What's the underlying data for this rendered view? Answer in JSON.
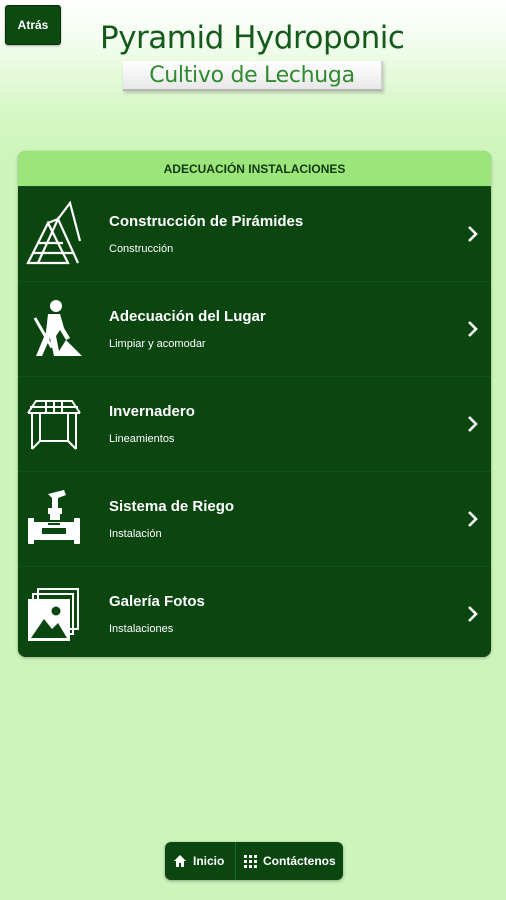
{
  "header": {
    "back_label": "Atrás",
    "title": "Pyramid Hydroponic",
    "subtitle": "Cultivo de Lechuga"
  },
  "panel": {
    "heading": "ADECUACIÓN INSTALACIONES",
    "items": [
      {
        "label": "Construcción de Pirámides",
        "sub": "Construcción",
        "icon": "pyramid-icon"
      },
      {
        "label": "Adecuación del Lugar",
        "sub": "Limpiar y acomodar",
        "icon": "worker-shovel-icon"
      },
      {
        "label": "Invernadero",
        "sub": "Lineamientos",
        "icon": "greenhouse-icon"
      },
      {
        "label": "Sistema de Riego",
        "sub": "Instalación",
        "icon": "faucet-pipe-icon"
      },
      {
        "label": "Galería Fotos",
        "sub": "Instalaciones",
        "icon": "photo-gallery-icon"
      }
    ]
  },
  "footer": {
    "home_label": "Inicio",
    "contact_label": "Contáctenos"
  },
  "colors": {
    "dark_green": "#0b4611",
    "header_green": "#9ce57a",
    "background": "#cdf5bb",
    "title_green": "#145a1c"
  }
}
